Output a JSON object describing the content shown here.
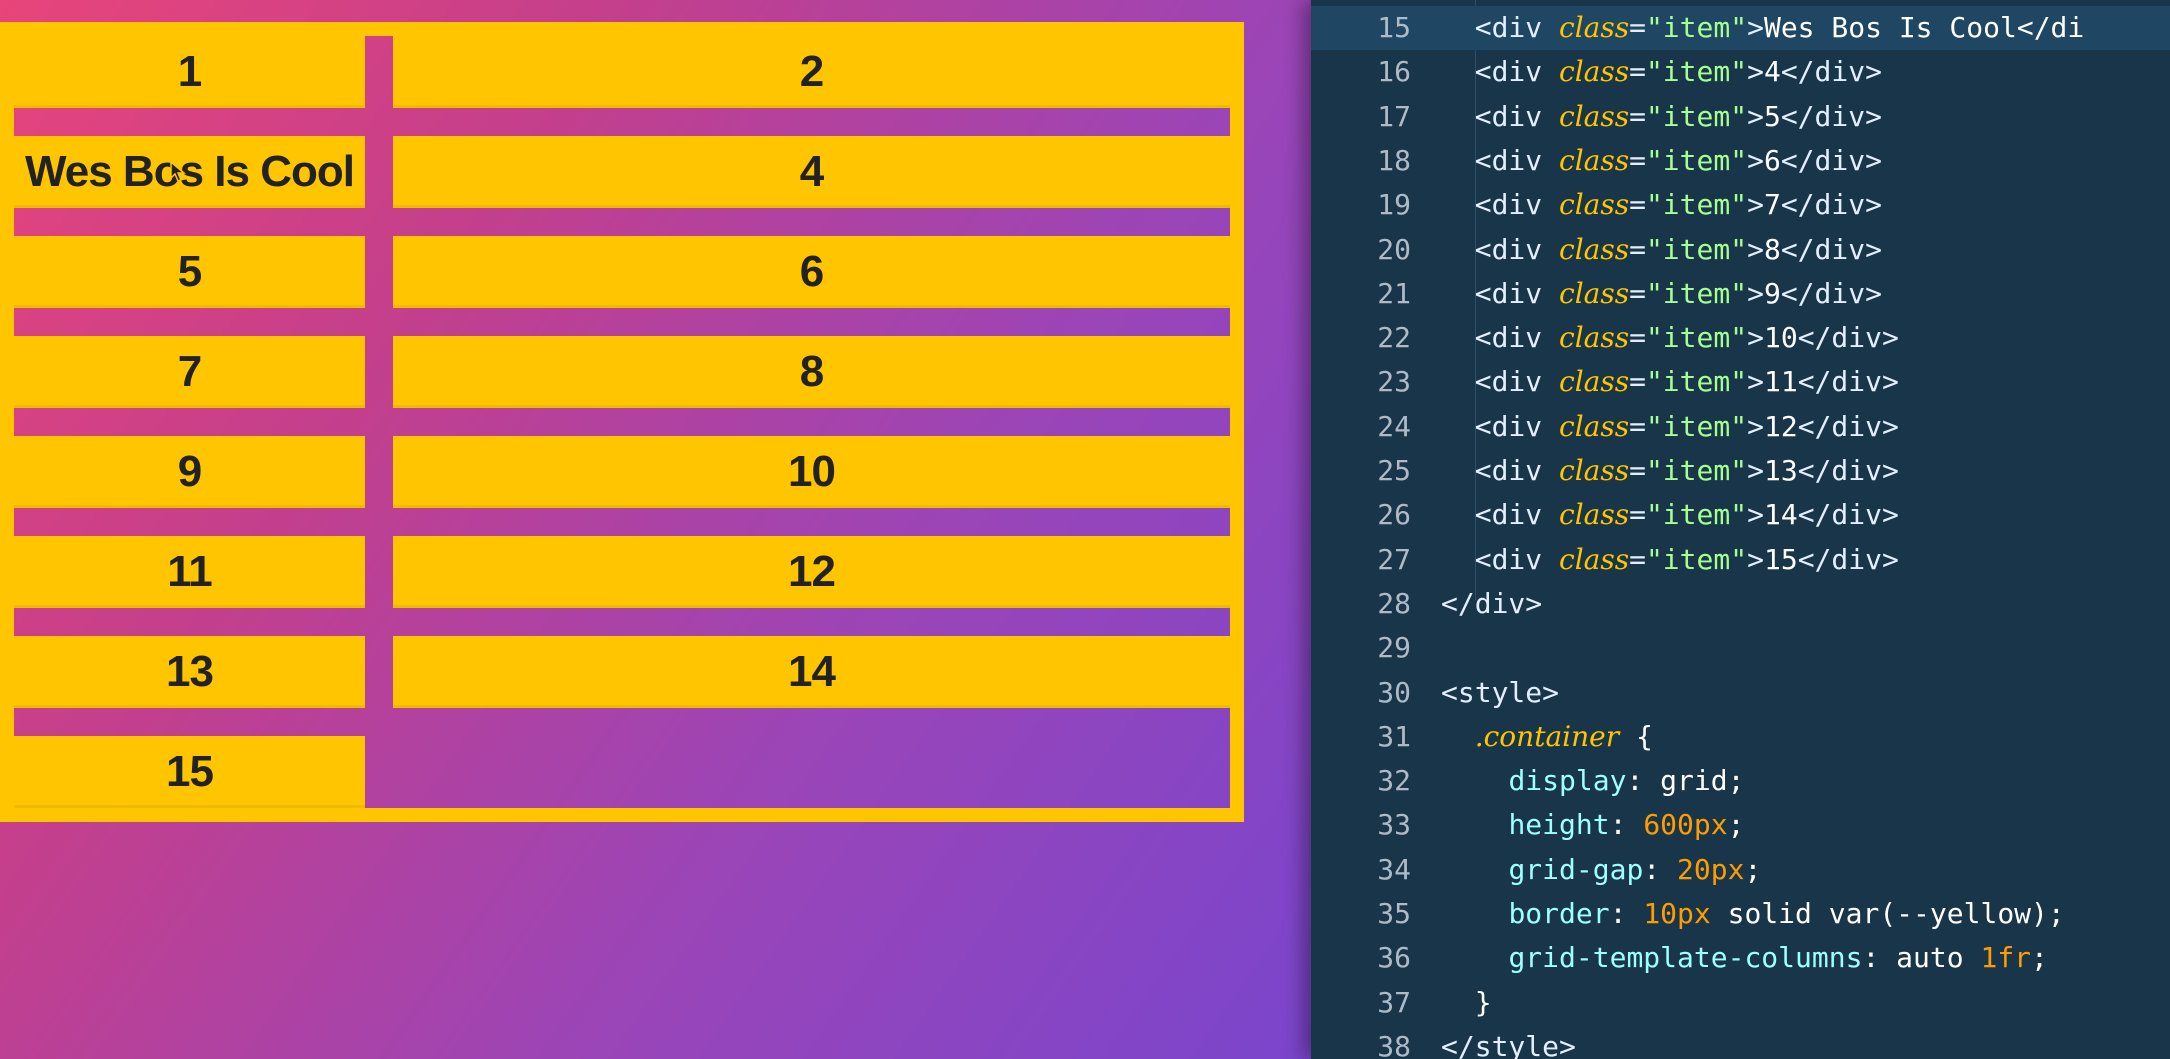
{
  "preview": {
    "items": [
      "1",
      "2",
      "Wes Bos Is Cool",
      "4",
      "5",
      "6",
      "7",
      "8",
      "9",
      "10",
      "11",
      "12",
      "13",
      "14",
      "15"
    ]
  },
  "editor": {
    "lines": [
      {
        "num": "15",
        "code": "  <div class=\"item\">Wes Bos Is Cool</di"
      },
      {
        "num": "16",
        "code": "  <div class=\"item\">4</div>"
      },
      {
        "num": "17",
        "code": "  <div class=\"item\">5</div>"
      },
      {
        "num": "18",
        "code": "  <div class=\"item\">6</div>"
      },
      {
        "num": "19",
        "code": "  <div class=\"item\">7</div>"
      },
      {
        "num": "20",
        "code": "  <div class=\"item\">8</div>"
      },
      {
        "num": "21",
        "code": "  <div class=\"item\">9</div>"
      },
      {
        "num": "22",
        "code": "  <div class=\"item\">10</div>"
      },
      {
        "num": "23",
        "code": "  <div class=\"item\">11</div>"
      },
      {
        "num": "24",
        "code": "  <div class=\"item\">12</div>"
      },
      {
        "num": "25",
        "code": "  <div class=\"item\">13</div>"
      },
      {
        "num": "26",
        "code": "  <div class=\"item\">14</div>"
      },
      {
        "num": "27",
        "code": "  <div class=\"item\">15</div>"
      },
      {
        "num": "28",
        "code": "</div>"
      },
      {
        "num": "29",
        "code": ""
      },
      {
        "num": "30",
        "code": "<style>"
      },
      {
        "num": "31",
        "code": "  .container {"
      },
      {
        "num": "32",
        "code": "    display: grid;"
      },
      {
        "num": "33",
        "code": "    height: 600px;"
      },
      {
        "num": "34",
        "code": "    grid-gap: 20px;"
      },
      {
        "num": "35",
        "code": "    border: 10px solid var(--yellow);"
      },
      {
        "num": "36",
        "code": "    grid-template-columns: auto 1fr;"
      },
      {
        "num": "37",
        "code": "  }"
      },
      {
        "num": "38",
        "code": "</style>"
      }
    ],
    "active_line": "15"
  },
  "colors": {
    "yellow": "#ffc600",
    "editor_bg": "#193549"
  }
}
